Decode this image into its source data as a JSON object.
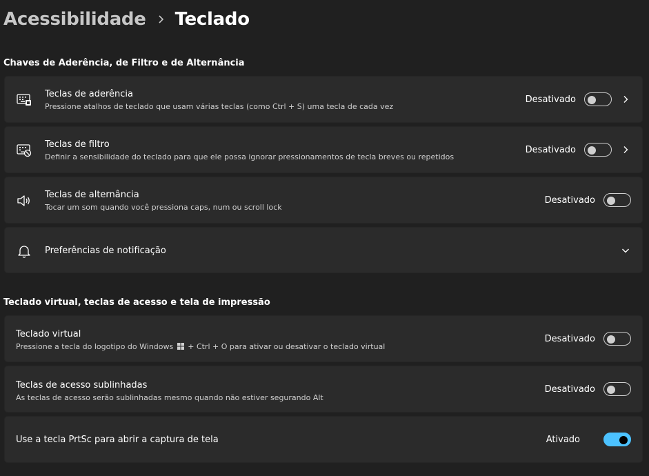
{
  "breadcrumb": {
    "parent": "Acessibilidade",
    "current": "Teclado"
  },
  "sections": {
    "section1_title": "Chaves de Aderência, de Filtro e de Alternância",
    "section2_title": "Teclado virtual, teclas de acesso e tela de impressão"
  },
  "rows": {
    "sticky": {
      "title": "Teclas de aderência",
      "desc": "Pressione atalhos de teclado que usam várias teclas (como Ctrl + S) uma tecla de cada vez",
      "state": "Desativado",
      "icon": "sticky-keys-icon"
    },
    "filter": {
      "title": "Teclas de filtro",
      "desc": "Definir a sensibilidade do teclado para que ele possa ignorar pressionamentos de tecla breves ou repetidos",
      "state": "Desativado",
      "icon": "filter-keys-icon"
    },
    "toggle": {
      "title": "Teclas de alternância",
      "desc": "Tocar um som quando você pressiona caps, num ou scroll lock",
      "state": "Desativado",
      "icon": "speaker-icon"
    },
    "notifications": {
      "title": "Preferências de notificação",
      "icon": "bell-icon"
    },
    "osk": {
      "title": "Teclado virtual",
      "desc_before": "Pressione a tecla do logotipo do Windows",
      "desc_after": "+ Ctrl + O para ativar ou desativar o teclado virtual",
      "state": "Desativado"
    },
    "underline": {
      "title": "Teclas de acesso sublinhadas",
      "desc": "As teclas de acesso serão sublinhadas mesmo quando não estiver segurando Alt",
      "state": "Desativado"
    },
    "prtsc": {
      "title": "Use a tecla PrtSc para abrir a captura de tela",
      "state": "Ativado"
    }
  },
  "colors": {
    "accent": "#4cc2ff",
    "background": "#202020",
    "card": "#2b2b2b"
  }
}
